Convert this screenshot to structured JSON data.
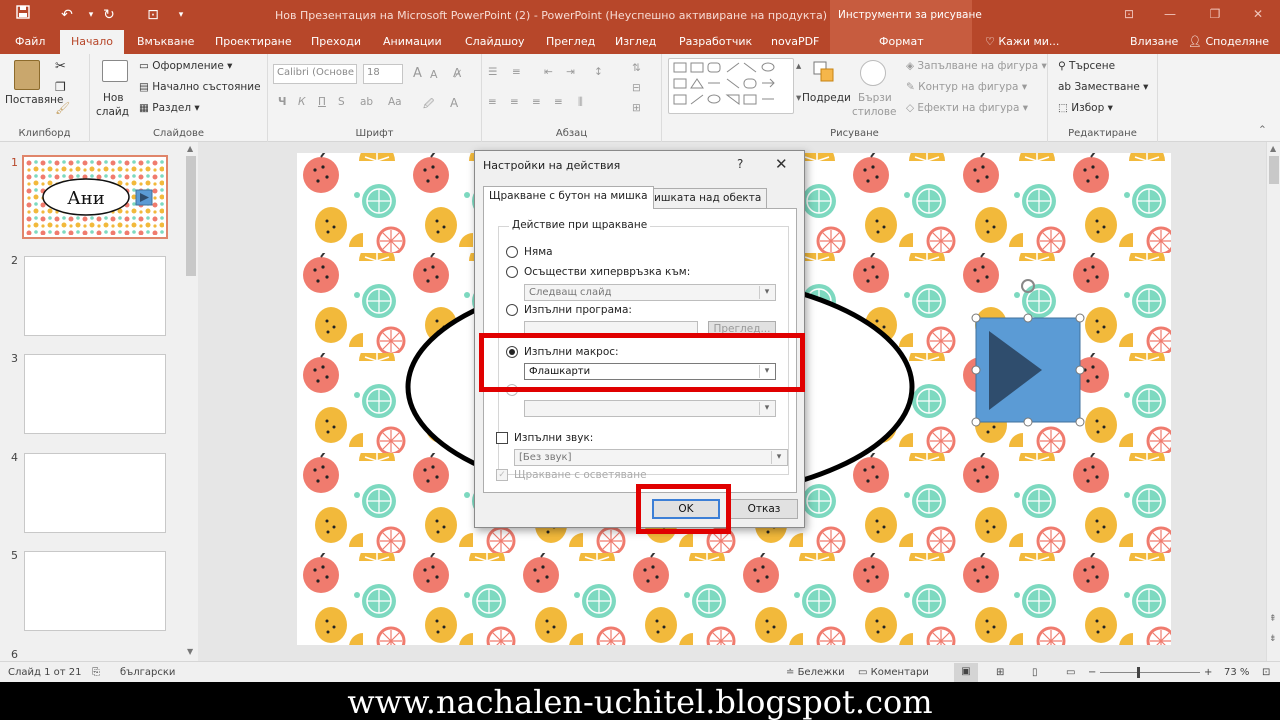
{
  "titlebar": {
    "title": "Нов Презентация на Microsoft PowerPoint (2) - PowerPoint (Неуспешно активиране на продукта)",
    "context_tools": "Инструменти за рисуване"
  },
  "tabs": {
    "items": [
      "Файл",
      "Начало",
      "Вмъкване",
      "Проектиране",
      "Преходи",
      "Анимации",
      "Слайдшоу",
      "Преглед",
      "Изглед",
      "Разработчик",
      "novaPDF",
      "Формат"
    ],
    "tell_me": "Кажи ми...",
    "signin": "Влизане",
    "share": "Споделяне"
  },
  "ribbon": {
    "clipboard": {
      "paste": "Поставяне",
      "label": "Клипборд"
    },
    "slides": {
      "new_slide_1": "Нов",
      "new_slide_2": "слайд",
      "layout": "Оформление",
      "reset": "Начално състояние",
      "section": "Раздел",
      "label": "Слайдове"
    },
    "font": {
      "font_name": "Calibri (Основе",
      "font_size": "18",
      "bold": "Ч",
      "italic": "К",
      "underline": "П",
      "strike": "S",
      "label": "Шрифт"
    },
    "paragraph": {
      "label": "Абзац"
    },
    "drawing": {
      "arrange": "Подреди",
      "quick_styles_1": "Бързи",
      "quick_styles_2": "стилове",
      "fill": "Запълване на фигура",
      "outline": "Контур на фигура",
      "effects": "Ефекти на фигура",
      "label": "Рисуване"
    },
    "editing": {
      "find": "Търсене",
      "replace": "Заместване",
      "select": "Избор",
      "label": "Редактиране"
    }
  },
  "thumbnails": {
    "numbers": [
      "1",
      "2",
      "3",
      "4",
      "5",
      "6"
    ],
    "slide1_text": "Ани"
  },
  "dialog": {
    "title": "Настройки на действия",
    "help": "?",
    "close": "✕",
    "tab_click": "Щракване с бутон на мишка",
    "tab_hover": "Мишката над обекта",
    "group_label": "Действие при щракване",
    "opt_none": "Няма",
    "opt_hyperlink": "Осъществи хипервръзка към:",
    "hyperlink_value": "Следващ слайд",
    "opt_program": "Изпълни програма:",
    "browse": "Преглед...",
    "opt_macro": "Изпълни макрос:",
    "macro_value": "Флашкарти",
    "opt_sound": "Изпълни звук:",
    "sound_value": "[Без звук]",
    "opt_highlight": "Щракване с осветяване",
    "ok": "OK",
    "cancel": "Отказ"
  },
  "statusbar": {
    "slide_info": "Слайд 1 от 21",
    "language": "български",
    "notes": "Бележки",
    "comments": "Коментари",
    "zoom": "73 %"
  },
  "footer": {
    "url": "www.nachalen-uchitel.blogspot.com"
  },
  "colors": {
    "accent": "#b7472a",
    "highlight_red": "#e00000",
    "action_button": "#5b9bd5"
  }
}
